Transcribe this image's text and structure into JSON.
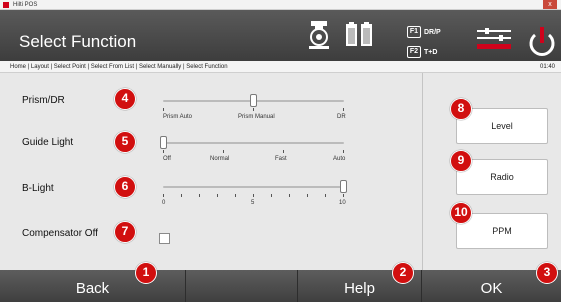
{
  "window": {
    "title": "Hilti POS",
    "close_glyph": "x"
  },
  "header": {
    "title": "Select Function",
    "icons": [
      "prism-icon",
      "battery-icon",
      "function-keys-icon",
      "settings-icon",
      "power-icon"
    ],
    "f_keys": [
      {
        "key": "F1",
        "label": "DR/P"
      },
      {
        "key": "F2",
        "label": "T+D"
      }
    ]
  },
  "breadcrumb": {
    "path": "Home | Layout | Select Point | Select From List | Select Manually | Select Function",
    "time": "01:40"
  },
  "settings": {
    "prism_dr": {
      "label": "Prism/DR",
      "ticks": [
        "Prism Auto",
        "Prism Manual",
        "DR"
      ],
      "value_index": 1
    },
    "guide_light": {
      "label": "Guide Light",
      "ticks": [
        "Off",
        "Normal",
        "Fast",
        "Auto"
      ],
      "value_index": 0
    },
    "b_light": {
      "label": "B-Light",
      "ticks": [
        "0",
        "5",
        "10"
      ],
      "min": 0,
      "max": 10,
      "value": 10
    },
    "compensator_off": {
      "label": "Compensator Off",
      "checked": false
    }
  },
  "side_buttons": {
    "level": "Level",
    "radio": "Radio",
    "ppm": "PPM"
  },
  "bottom_bar": {
    "back": "Back",
    "help": "Help",
    "ok": "OK"
  },
  "callouts": [
    "1",
    "2",
    "3",
    "4",
    "5",
    "6",
    "7",
    "8",
    "9",
    "10"
  ],
  "colors": {
    "header": "#4a4a4a",
    "badge": "#d10f0f",
    "accent_red": "#d0021b"
  }
}
